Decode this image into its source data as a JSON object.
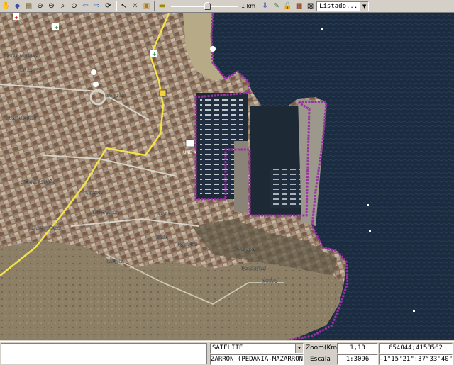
{
  "toolbar": {
    "icons": [
      "hand-pan",
      "layers",
      "map-export",
      "zoom-in",
      "zoom-out",
      "zoom-window",
      "zoom-extent",
      "previous-view",
      "next-view",
      "refresh",
      "select-arrow",
      "delete",
      "package",
      "measure-ruler"
    ],
    "scale_label": "1 km",
    "slider_level": 0.55,
    "right_icons": [
      "pin",
      "pencil",
      "lock",
      "table",
      "grid"
    ],
    "list_combo": "Listado..."
  },
  "map": {
    "view": "satellite",
    "label_street_1": "SIERRA MORENA",
    "label_street_2": "DE LA PLA",
    "label_street_3": "GUADALENTIN",
    "label_street_4": "GAVIOTA",
    "label_street_5": "SIERRA ESPUÑA",
    "label_street_6": "EMPERADOR",
    "label_street_7": "ROTANA",
    "label_street_8": "TORRE",
    "label_street_9": "ROSA",
    "label_street_10": "BARRENDEROS",
    "label_street_11": "PEDRERO",
    "label_street_12": "GRANADA",
    "label_street_13": "RAMBLA",
    "label_street_14": "NOVALETAS",
    "label_street_15": "NUEVO",
    "label_poi": "UNE 4",
    "colors": {
      "sea": "#1a2a3c",
      "road_main": "#f3e34a",
      "boundary": "#9b2fa6",
      "urban": "#8c7a68",
      "dry_land": "#8f8268"
    }
  },
  "status": {
    "layer_value": "SATELITE",
    "zoom_label": "Zoom(Km)",
    "zoom_value": "1,13",
    "coords_value": "654044;4158562",
    "location_value": "ZARRON (PEDANIA-MAZARRON)",
    "scale_label": "Escala",
    "scale_value": "1:3096",
    "geo_value": "-1°15'21\";37°33'40\""
  }
}
